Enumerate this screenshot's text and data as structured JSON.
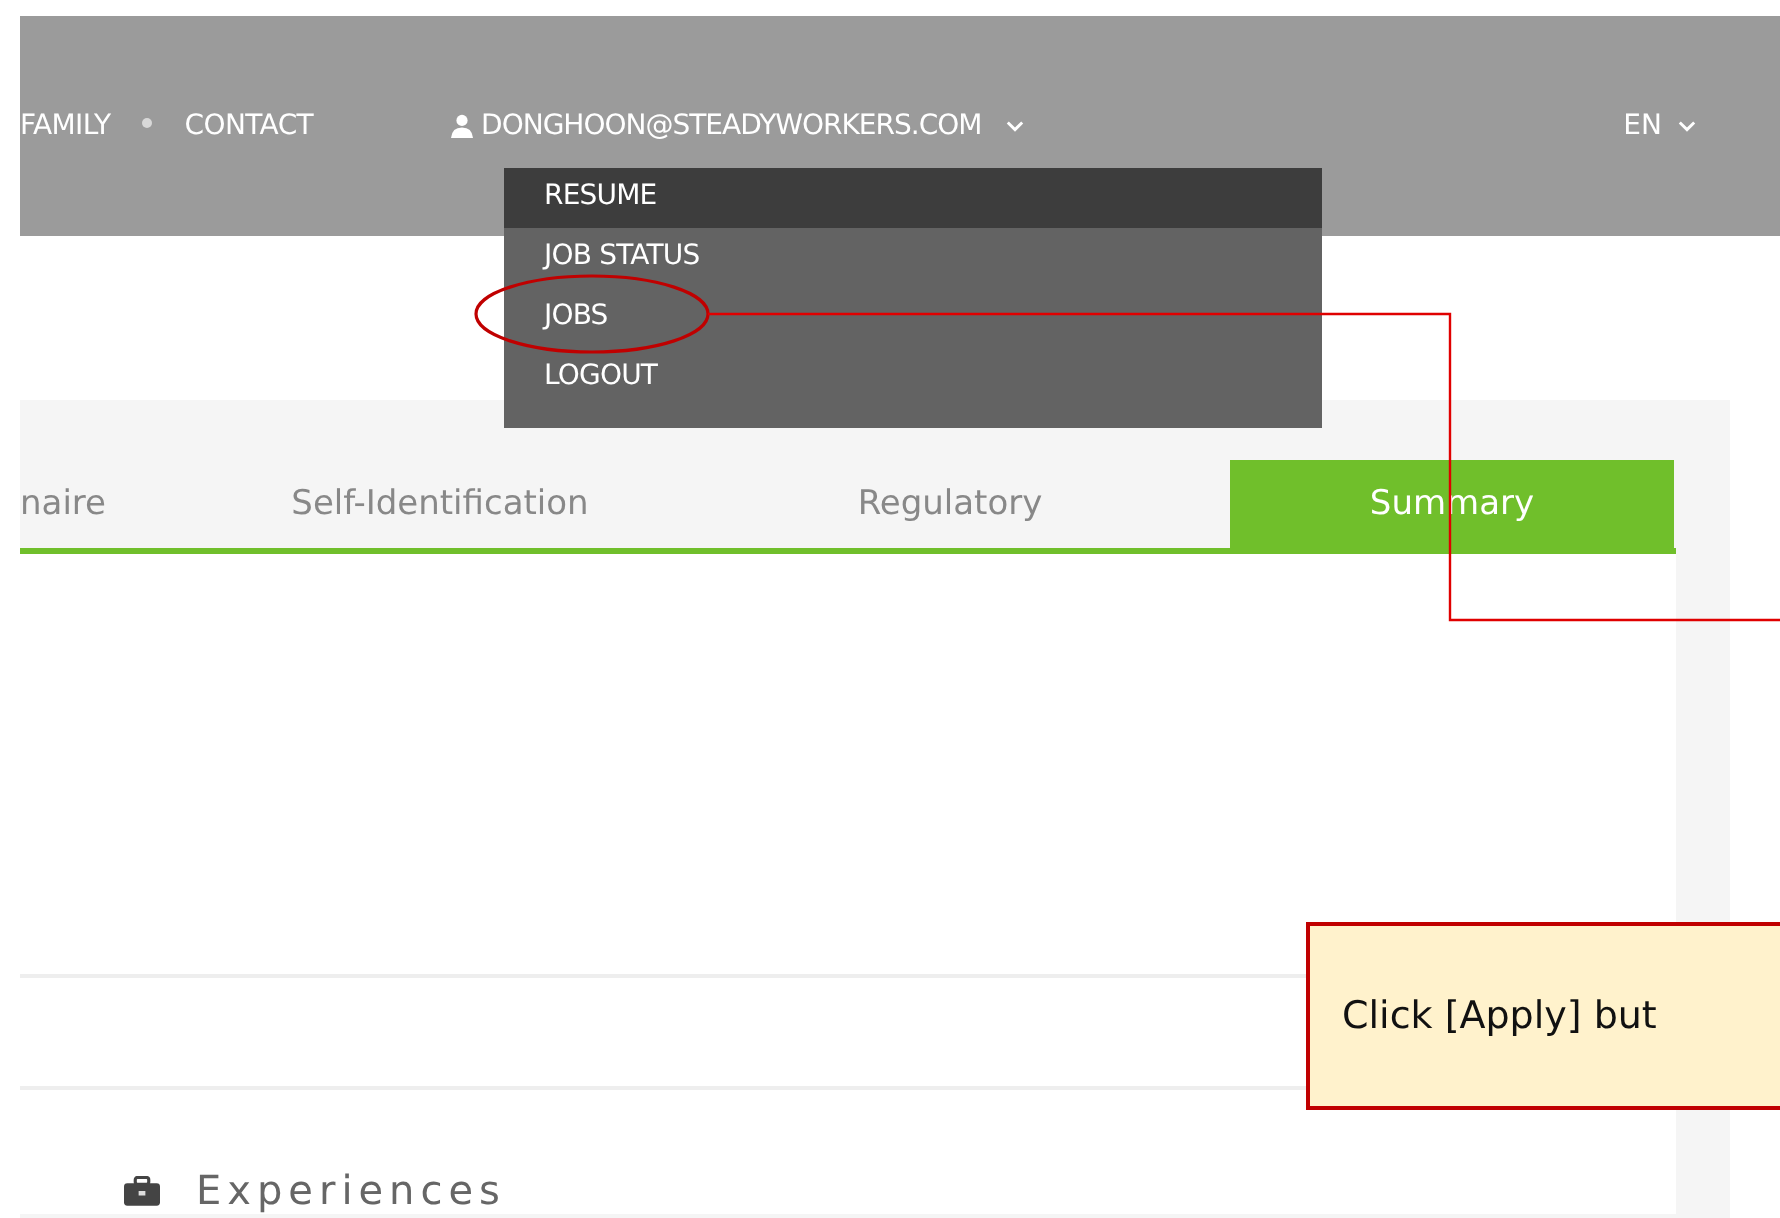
{
  "nav": {
    "items": [
      {
        "label": "FAMILY"
      },
      {
        "label": "CONTACT"
      }
    ],
    "email": "DONGHOON@STEADYWORKERS.COM",
    "language": "EN"
  },
  "user_menu": {
    "items": [
      {
        "label": "RESUME",
        "selected": true
      },
      {
        "label": "JOB STATUS",
        "selected": false
      },
      {
        "label": "JOBS",
        "selected": false
      },
      {
        "label": "LOGOUT",
        "selected": false
      }
    ]
  },
  "tabs": [
    {
      "label": "naire",
      "selected": false
    },
    {
      "label": "Self-Identification",
      "selected": false
    },
    {
      "label": "Regulatory",
      "selected": false
    },
    {
      "label": "Summary",
      "selected": true
    }
  ],
  "sections": [
    {
      "title": "Experiences"
    }
  ],
  "annotation": {
    "text": "Click [Apply] but"
  }
}
